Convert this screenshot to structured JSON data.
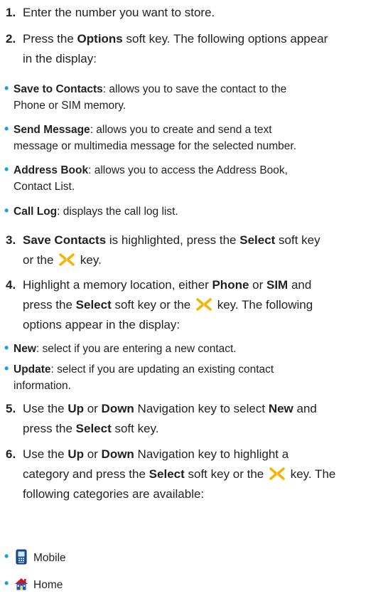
{
  "steps": [
    {
      "num": "1.",
      "text": "Enter the number you want to store."
    },
    {
      "num": "2.",
      "a": "Press the ",
      "b": "Options",
      "c": " soft key. The following options appear",
      "line2": "in the display:"
    },
    {
      "num": "3.",
      "a": "Save Contacts",
      "b": " is highlighted, press the ",
      "c": "Select",
      "d": " soft key",
      "line2a": "or the ",
      "line2b": " key."
    },
    {
      "num": "4.",
      "a": "Highlight a memory location, either ",
      "b": "Phone",
      "c": " or ",
      "d": "SIM",
      "e": " and",
      "line2a": "press the ",
      "line2b": "Select",
      "line2c": " soft key or the ",
      "line2d": " key. The following",
      "line3": "options appear in the display:"
    },
    {
      "num": "5.",
      "a": "Use the ",
      "b": "Up",
      "c": " or ",
      "d": "Down",
      "e": " Navigation key to select ",
      "f": "New",
      "g": " and",
      "line2a": "press the ",
      "line2b": "Select",
      "line2c": " soft key."
    },
    {
      "num": "6.",
      "a": "Use the ",
      "b": "Up",
      "c": " or ",
      "d": "Down",
      "e": " Navigation key to highlight a",
      "line2a": "category and press the ",
      "line2b": "Select",
      "line2c": " soft key or the ",
      "line2d": " key. The",
      "line3": "following categories are available:"
    }
  ],
  "options_step2": [
    {
      "term": "Save to Contacts",
      "desc": ": allows you to save the contact to the",
      "line2": "Phone or SIM memory."
    },
    {
      "term": "Send Message",
      "desc": ": allows you to create and send a text",
      "line2": "message or multimedia message for the selected number."
    },
    {
      "term": "Address Book",
      "desc": ": allows you to access the Address Book,",
      "line2": "Contact List."
    },
    {
      "term": "Call Log",
      "desc": ": displays the call log list."
    }
  ],
  "options_step4": [
    {
      "term": "New",
      "desc": ": select if you are entering a new contact."
    },
    {
      "term": "Update",
      "desc": ": select if you are updating an existing contact",
      "line2": "information."
    }
  ],
  "categories": [
    {
      "label": "Mobile",
      "icon": "mobile-phone-icon"
    },
    {
      "label": "Home",
      "icon": "home-icon"
    }
  ],
  "bullet_glyph": "•",
  "colors": {
    "text": "#231f20",
    "bullet": "#1aa0e0",
    "navkey": "#f5b400"
  }
}
